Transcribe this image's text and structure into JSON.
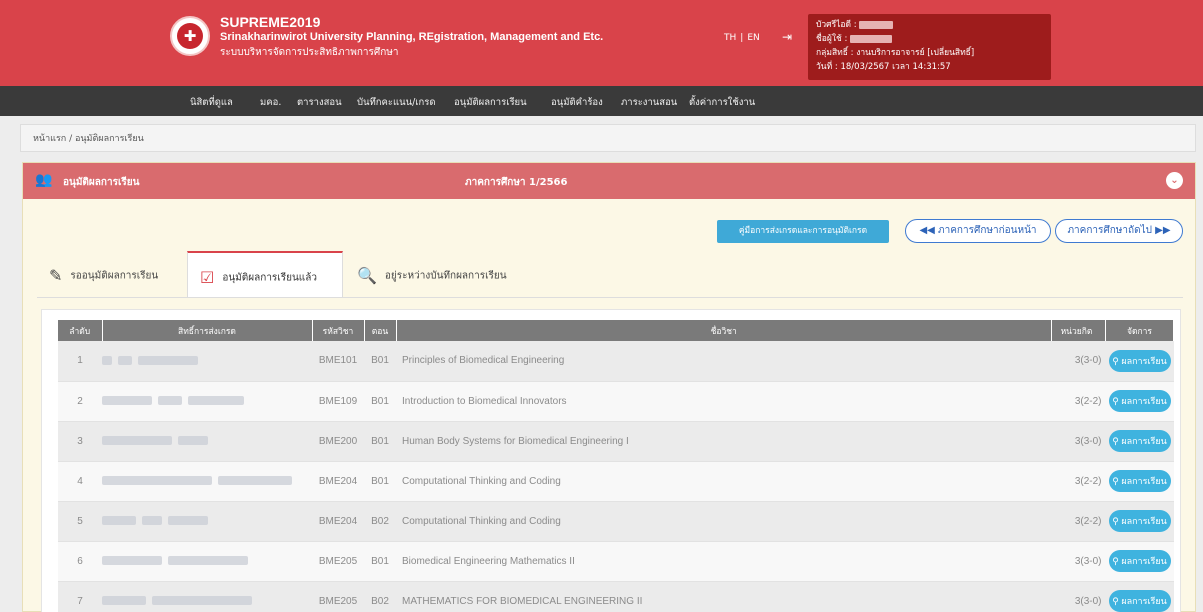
{
  "header": {
    "app_name": "SUPREME2019",
    "app_fullname": "Srinakharinwirot University Planning, REgistration, Management and Etc.",
    "app_thai": "ระบบบริหารจัดการประสิทธิภาพการศึกษา",
    "lang_th": "TH",
    "lang_sep": "|",
    "lang_en": "EN",
    "user_id_label": "บัวศรีไอดี :",
    "user_name_label": "ชื่อผู้ใช้ :",
    "user_group": "กลุ่มสิทธิ์ : งานบริการอาจารย์ [เปลี่ยนสิทธิ์]",
    "user_date": "วันที่ : 18/03/2567 เวลา 14:31:57",
    "brand_color": "#d9434a"
  },
  "nav": {
    "items": [
      "นิสิตที่ดูแล",
      "มคอ.",
      "ตารางสอน",
      "บันทึกคะแนน/เกรด",
      "อนุมัติผลการเรียน",
      "อนุมัติคำร้อง",
      "ภาระงานสอน",
      "ตั้งค่าการใช้งาน"
    ]
  },
  "breadcrumb": {
    "text": "หน้าแรก / อนุมัติผลการเรียน"
  },
  "panel": {
    "title": "อนุมัติผลการเรียน",
    "term": "ภาคการศึกษา 1/2566",
    "guide_button": "คู่มือการส่งเกรดและการอนุมัติเกรด",
    "prev_button": "ภาคการศึกษาก่อนหน้า",
    "next_button": "ภาคการศึกษาถัดไป"
  },
  "tabs": {
    "pending": "รออนุมัติผลการเรียน",
    "approved": "อนุมัติผลการเรียนแล้ว",
    "recording": "อยู่ระหว่างบันทึกผลการเรียน"
  },
  "table": {
    "headers": {
      "no": "ลำดับ",
      "rights": "สิทธิ์การส่งเกรด",
      "code": "รหัสวิชา",
      "section": "ตอน",
      "name": "ชื่อวิชา",
      "credits": "หน่วยกิต",
      "manage": "จัดการ"
    },
    "action_label": "ผลการเรียน",
    "rows": [
      {
        "no": "1",
        "code": "BME101",
        "section": "B01",
        "name": "Principles of Biomedical Engineering",
        "credits": "3(3-0)"
      },
      {
        "no": "2",
        "code": "BME109",
        "section": "B01",
        "name": "Introduction to Biomedical Innovators",
        "credits": "3(2-2)"
      },
      {
        "no": "3",
        "code": "BME200",
        "section": "B01",
        "name": "Human Body Systems for Biomedical Engineering I",
        "credits": "3(3-0)"
      },
      {
        "no": "4",
        "code": "BME204",
        "section": "B01",
        "name": "Computational Thinking and Coding",
        "credits": "3(2-2)"
      },
      {
        "no": "5",
        "code": "BME204",
        "section": "B02",
        "name": "Computational Thinking and Coding",
        "credits": "3(2-2)"
      },
      {
        "no": "6",
        "code": "BME205",
        "section": "B01",
        "name": "Biomedical Engineering Mathematics II",
        "credits": "3(3-0)"
      },
      {
        "no": "7",
        "code": "BME205",
        "section": "B02",
        "name": "MATHEMATICS FOR BIOMEDICAL ENGINEERING II",
        "credits": "3(3-0)"
      }
    ]
  }
}
